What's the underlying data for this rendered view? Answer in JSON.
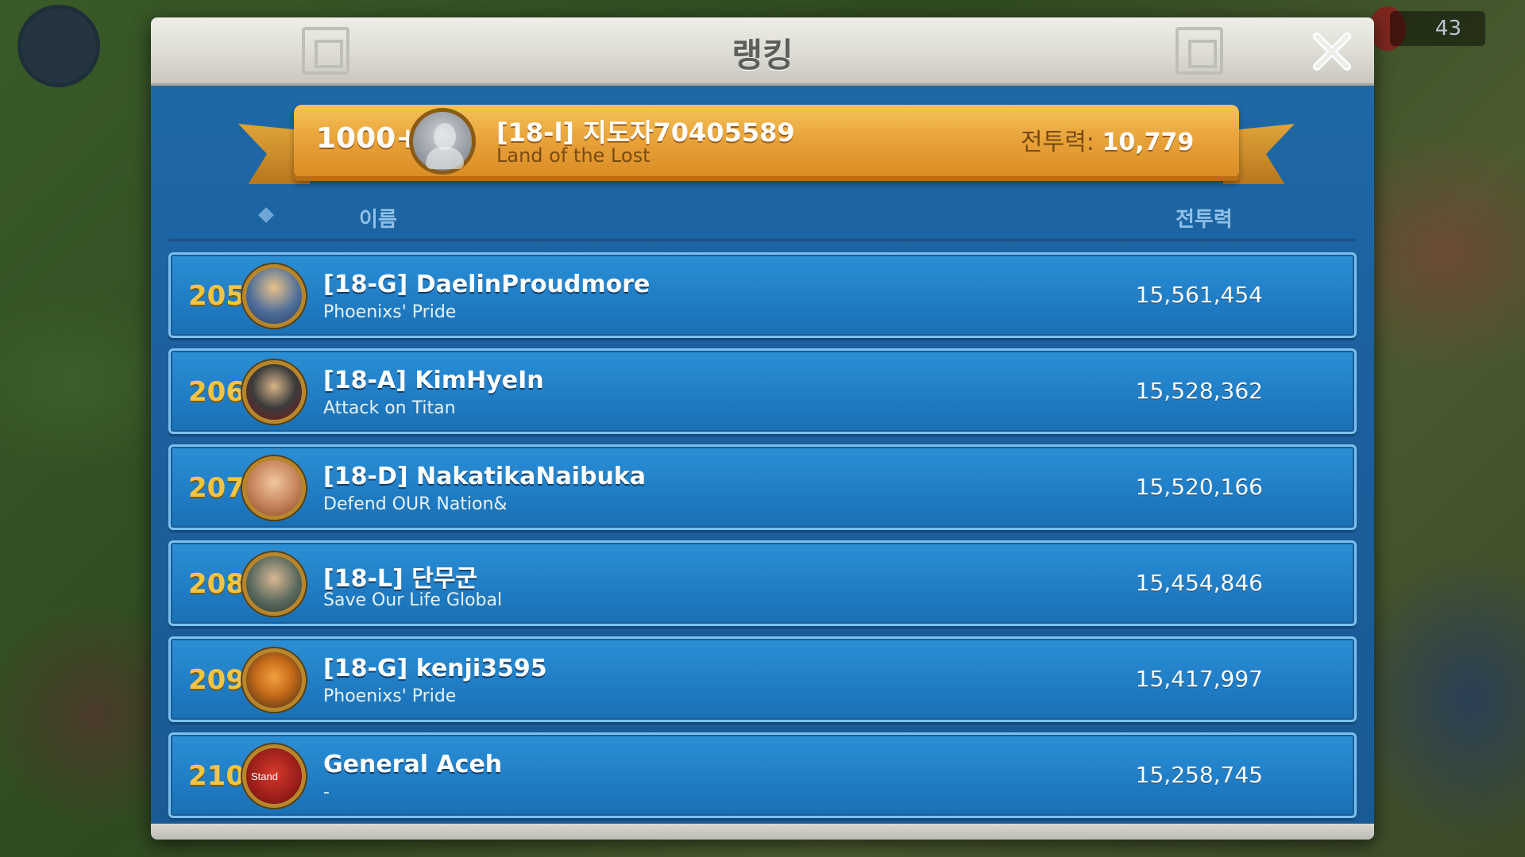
{
  "modal": {
    "title": "랭킹"
  },
  "player": {
    "rank": "1000+",
    "name": "[18-l] 지도자70405589",
    "alliance": "Land of the Lost",
    "power_label": "전투력:",
    "power_value": "10,779"
  },
  "columns": {
    "name": "이름",
    "power": "전투력"
  },
  "rows": [
    {
      "rank": "205",
      "name": "[18-G] DaelinProudmore",
      "alliance": "Phoenixs' Pride",
      "power": "15,561,454"
    },
    {
      "rank": "206",
      "name": "[18-A] KimHyeIn",
      "alliance": "Attack on Titan",
      "power": "15,528,362"
    },
    {
      "rank": "207",
      "name": "[18-D] NakatikaNaibuka",
      "alliance": "Defend OUR Nation&",
      "power": "15,520,166"
    },
    {
      "rank": "208",
      "name": "[18-L] 단무군",
      "alliance": "Save Our Life Global",
      "power": "15,454,846"
    },
    {
      "rank": "209",
      "name": "[18-G] kenji3595",
      "alliance": "Phoenixs' Pride",
      "power": "15,417,997"
    },
    {
      "rank": "210",
      "name": "General Aceh",
      "alliance": "-",
      "power": "15,258,745",
      "avatar_text": "Stand"
    }
  ],
  "background": {
    "counter": "43"
  },
  "icons": {
    "close": "close-icon",
    "sort": "diamond-sort-icon"
  },
  "colors": {
    "panel_blue": "#1f6aa8",
    "row_blue": "#2b8fd6",
    "rank_gold": "#f3c545",
    "banner_gold": "#e8a33a"
  }
}
